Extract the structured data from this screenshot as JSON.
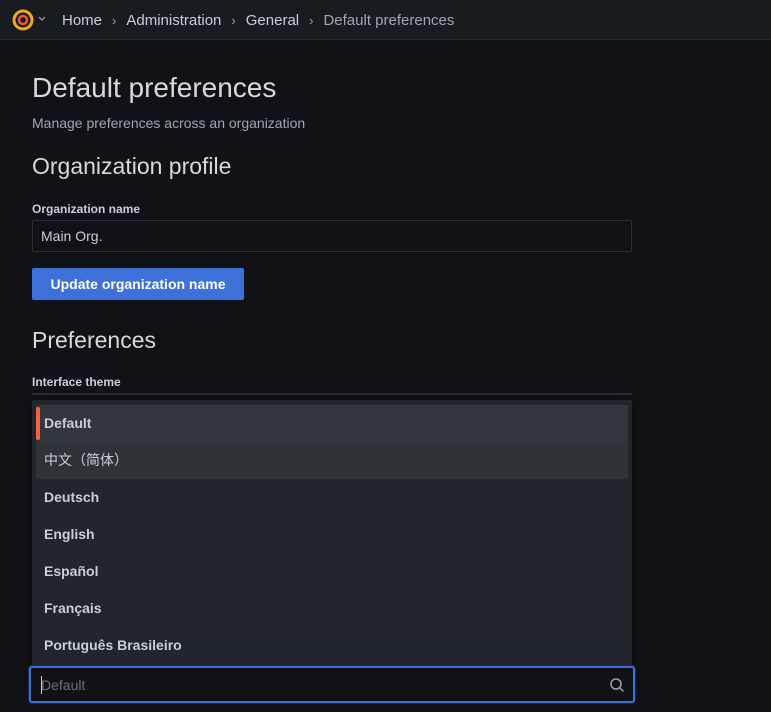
{
  "breadcrumbs": {
    "items": [
      "Home",
      "Administration",
      "General"
    ],
    "current": "Default preferences"
  },
  "page": {
    "title": "Default preferences",
    "subtitle": "Manage preferences across an organization"
  },
  "org_profile": {
    "title": "Organization profile",
    "name_label": "Organization name",
    "name_value": "Main Org.",
    "update_button": "Update organization name"
  },
  "preferences": {
    "title": "Preferences",
    "theme_label": "Interface theme"
  },
  "language_dropdown": {
    "options": [
      "Default",
      "中文（简体）",
      "Deutsch",
      "English",
      "Español",
      "Français",
      "Português Brasileiro"
    ],
    "active_index": 0,
    "hover_index": 1,
    "search_placeholder": "Default"
  },
  "colors": {
    "accent_primary": "#3d71d9",
    "active_indicator": "#f55f3e",
    "background": "#111217"
  },
  "icons": {
    "logo": "grafana-logo",
    "caret": "chevron-down-icon",
    "search": "search-icon"
  }
}
